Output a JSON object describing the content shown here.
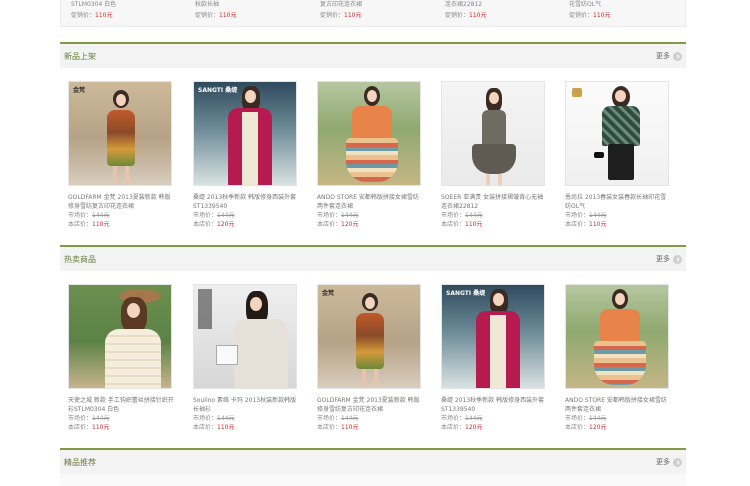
{
  "top_row": {
    "items": [
      {
        "name": "STLM0304 白色",
        "price_label": "促销价：",
        "price": "110元"
      },
      {
        "name": "秋款长袖",
        "price_label": "促销价：",
        "price": "110元"
      },
      {
        "name": "复古印花连衣裙",
        "price_label": "促销价：",
        "price": "110元"
      },
      {
        "name": "连衣裙22812",
        "price_label": "促销价：",
        "price": "110元"
      },
      {
        "name": "花雪纺OL气",
        "price_label": "促销价：",
        "price": "110元"
      }
    ]
  },
  "sections": [
    {
      "title": "新品上架",
      "more_label": "更多",
      "products": [
        {
          "name": "GOLDFARM 金梵 2013夏装新款 韩版修身雪纺复古印花连衣裙",
          "market_label": "市场价：",
          "market_price": "144元",
          "store_label": "本店价：",
          "store_price": "110元"
        },
        {
          "name": "桑缇 2013秋季新款 韩版修身西装外套 ST1339540",
          "market_label": "市场价：",
          "market_price": "144元",
          "store_label": "本店价：",
          "store_price": "120元"
        },
        {
          "name": "ANDO STORE 安都韩版拼接女裙雪纺两件套连衣裙",
          "market_label": "市场价：",
          "market_price": "144元",
          "store_label": "本店价：",
          "store_price": "120元"
        },
        {
          "name": "SOEER 亚满贵 女装拼接褶皱背心无袖连衣裙22812",
          "market_label": "市场价：",
          "market_price": "144元",
          "store_label": "本店价：",
          "store_price": "110元"
        },
        {
          "name": "恩尚拉 2013春装女装春款长袖印花雪纺OL气",
          "market_label": "市场价：",
          "market_price": "144元",
          "store_label": "本店价：",
          "store_price": "110元"
        }
      ]
    },
    {
      "title": "热卖商品",
      "more_label": "更多",
      "products": [
        {
          "name": "天使之城 新款 手工钩织蕾丝拼接针织开衫STLM0304 白色",
          "market_label": "市场价：",
          "market_price": "144元",
          "store_label": "本店价：",
          "store_price": "110元"
        },
        {
          "name": "Soulino 素络 卡玛 2013秋装新款韩版长袖衫",
          "market_label": "市场价：",
          "market_price": "144元",
          "store_label": "本店价：",
          "store_price": "110元"
        },
        {
          "name": "GOLDFARM 金梵 2013夏装新款 韩版修身雪纺复古印花连衣裙",
          "market_label": "市场价：",
          "market_price": "144元",
          "store_label": "本店价：",
          "store_price": "110元"
        },
        {
          "name": "桑缇 2013秋季新款 韩版修身西装外套 ST1339540",
          "market_label": "市场价：",
          "market_price": "144元",
          "store_label": "本店价：",
          "store_price": "120元"
        },
        {
          "name": "ANDO STORE 安都韩版拼接女裙雪纺两件套连衣裙",
          "market_label": "市场价：",
          "market_price": "144元",
          "store_label": "本店价：",
          "store_price": "120元"
        }
      ]
    },
    {
      "title": "精品推荐",
      "more_label": "更多",
      "products": []
    }
  ],
  "brand_marks": {
    "sanguti": "SANGTI 桑缇",
    "brand_left": "金梵"
  },
  "colors": {
    "accent": "#7e9a45",
    "price_red": "#cc2a2a",
    "section_bg": "#f3f3f3"
  }
}
